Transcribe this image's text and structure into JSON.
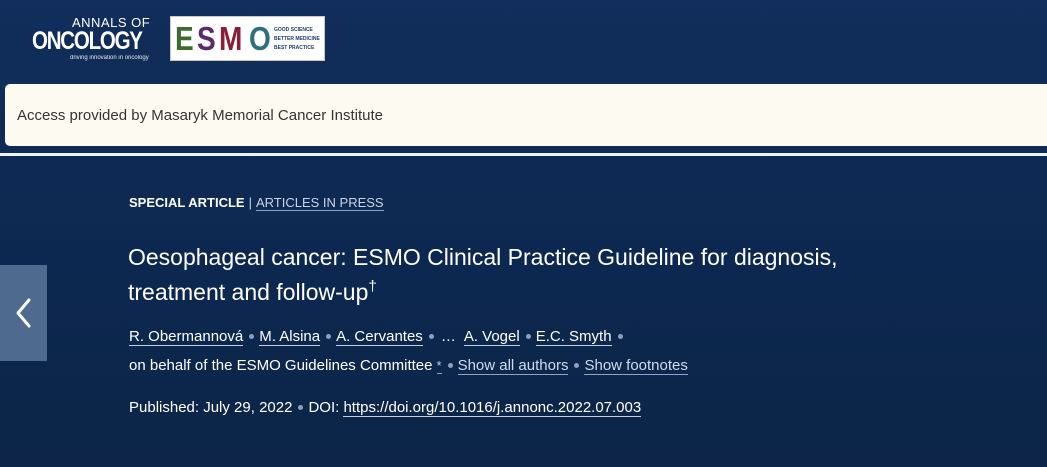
{
  "header": {
    "journal_logo": {
      "top": "ANNALS OF",
      "main": "ONCOLOGY",
      "tagline": "driving innovation in oncology"
    },
    "society_logo": {
      "letters": [
        "E",
        "S",
        "M",
        "O"
      ],
      "letter_colors": [
        "#3d6b2f",
        "#5a2a6e",
        "#8a1f3a",
        "#2e6e83"
      ],
      "tags": [
        "GOOD SCIENCE",
        "BETTER MEDICINE",
        "BEST PRACTICE"
      ]
    }
  },
  "access_banner": {
    "text": "Access provided by Masaryk Memorial Cancer Institute"
  },
  "article": {
    "type_label": "SPECIAL ARTICLE",
    "separator": "|",
    "status_link": "ARTICLES IN PRESS",
    "title": "Oesophageal cancer: ESMO Clinical Practice Guideline for diagnosis, treatment and follow-up",
    "title_footnote": "†",
    "authors": [
      "R. Obermannová",
      "M. Alsina",
      "A. Cervantes",
      "A. Vogel",
      "E.C. Smyth"
    ],
    "authors_ellipsis": "…",
    "committee": "on behalf of the ESMO Guidelines Committee",
    "committee_footnote": "*",
    "show_all_authors": "Show all authors",
    "show_footnotes": "Show footnotes",
    "published": "Published: July 29, 2022",
    "doi_label": "DOI:",
    "doi_link": "https://doi.org/10.1016/j.annonc.2022.07.003"
  },
  "nav": {
    "prev_icon": "chevron-left-icon"
  },
  "colors": {
    "background": "#0f2b56",
    "banner": "#fdfbf1",
    "arrow_bg": "#4e6a8e"
  }
}
